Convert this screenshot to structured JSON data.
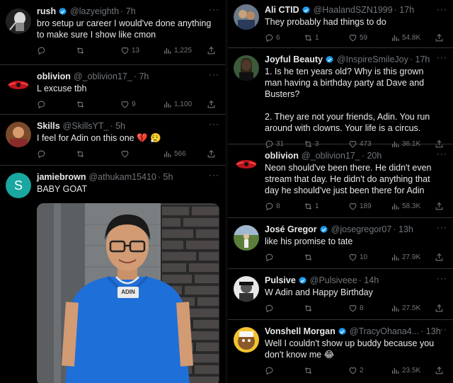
{
  "left": {
    "tweets": [
      {
        "name": "rush",
        "handle": "@lazyeighth",
        "time": "· 7h",
        "verified": true,
        "text": "bro setup ur career I would've done anything to make sure I show like cmon",
        "replies": "",
        "retweets": "",
        "likes": "13",
        "views": "1,225"
      },
      {
        "name": "oblivion",
        "handle": "@_oblivion17_",
        "time": "· 7h",
        "verified": false,
        "text": "L excuse tbh",
        "replies": "",
        "retweets": "",
        "likes": "9",
        "views": "1,100"
      },
      {
        "name": "Skills",
        "handle": "@SkillsYT_",
        "time": "· 5h",
        "verified": false,
        "text": "I feel for Adin on this one 💔 😮‍💨",
        "replies": "",
        "retweets": "",
        "likes": "",
        "views": "566"
      },
      {
        "name": "jamiebrown",
        "handle": "@athukam15410",
        "time": "· 5h",
        "verified": false,
        "avatar_letter": "S",
        "text": "BABY GOAT",
        "pendant_text": "ADIN"
      }
    ]
  },
  "right": {
    "tweets": [
      {
        "name": "Ali CTID",
        "handle": "@HaalandSZN1999",
        "time": "· 17h",
        "verified": true,
        "text": "They probably had things to do",
        "replies": "6",
        "retweets": "1",
        "likes": "59",
        "views": "54.8K"
      },
      {
        "name": "Joyful Beauty",
        "handle": "@InspireSmileJoy",
        "time": "· 17h",
        "verified": true,
        "text": "1. Is he ten years old? Why is this grown man having a birthday party at Dave and Busters?",
        "text2": "2. They are not your friends, Adin. You run around with clowns. Your life is a circus.",
        "replies": "31",
        "retweets": "3",
        "likes": "473",
        "views": "36.1K"
      },
      {
        "name": "oblivion",
        "handle": "@_oblivion17_",
        "time": "· 20h",
        "verified": false,
        "text": "Neon should've been there. He didn't even stream that day. He didn't do anything that day he should've just been there for Adin",
        "replies": "8",
        "retweets": "1",
        "likes": "189",
        "views": "58.3K"
      },
      {
        "name": "José Gregor",
        "handle": "@josegregor07",
        "time": "· 13h",
        "verified": true,
        "text": "like his promise to tate",
        "replies": "",
        "retweets": "",
        "likes": "10",
        "views": "27.9K"
      },
      {
        "name": "Pulsive",
        "handle": "@Pulsiveee",
        "time": "· 14h",
        "verified": true,
        "text": "W Adin and Happy Birthday",
        "replies": "",
        "retweets": "",
        "likes": "8",
        "views": "27.5K"
      },
      {
        "name": "Vonshell Morgan",
        "handle": "@TracyOhana4...",
        "time": "· 13h",
        "verified": true,
        "text": "Well I couldn't show up buddy because you don't know me 😂",
        "replies": "",
        "retweets": "",
        "likes": "2",
        "views": "23.5K"
      }
    ]
  },
  "more_glyph": "···",
  "colors": {
    "background": "#000000",
    "text": "#e7e9ea",
    "muted": "#71767b",
    "verified": "#1d9bf0",
    "divider": "#2f3336"
  }
}
